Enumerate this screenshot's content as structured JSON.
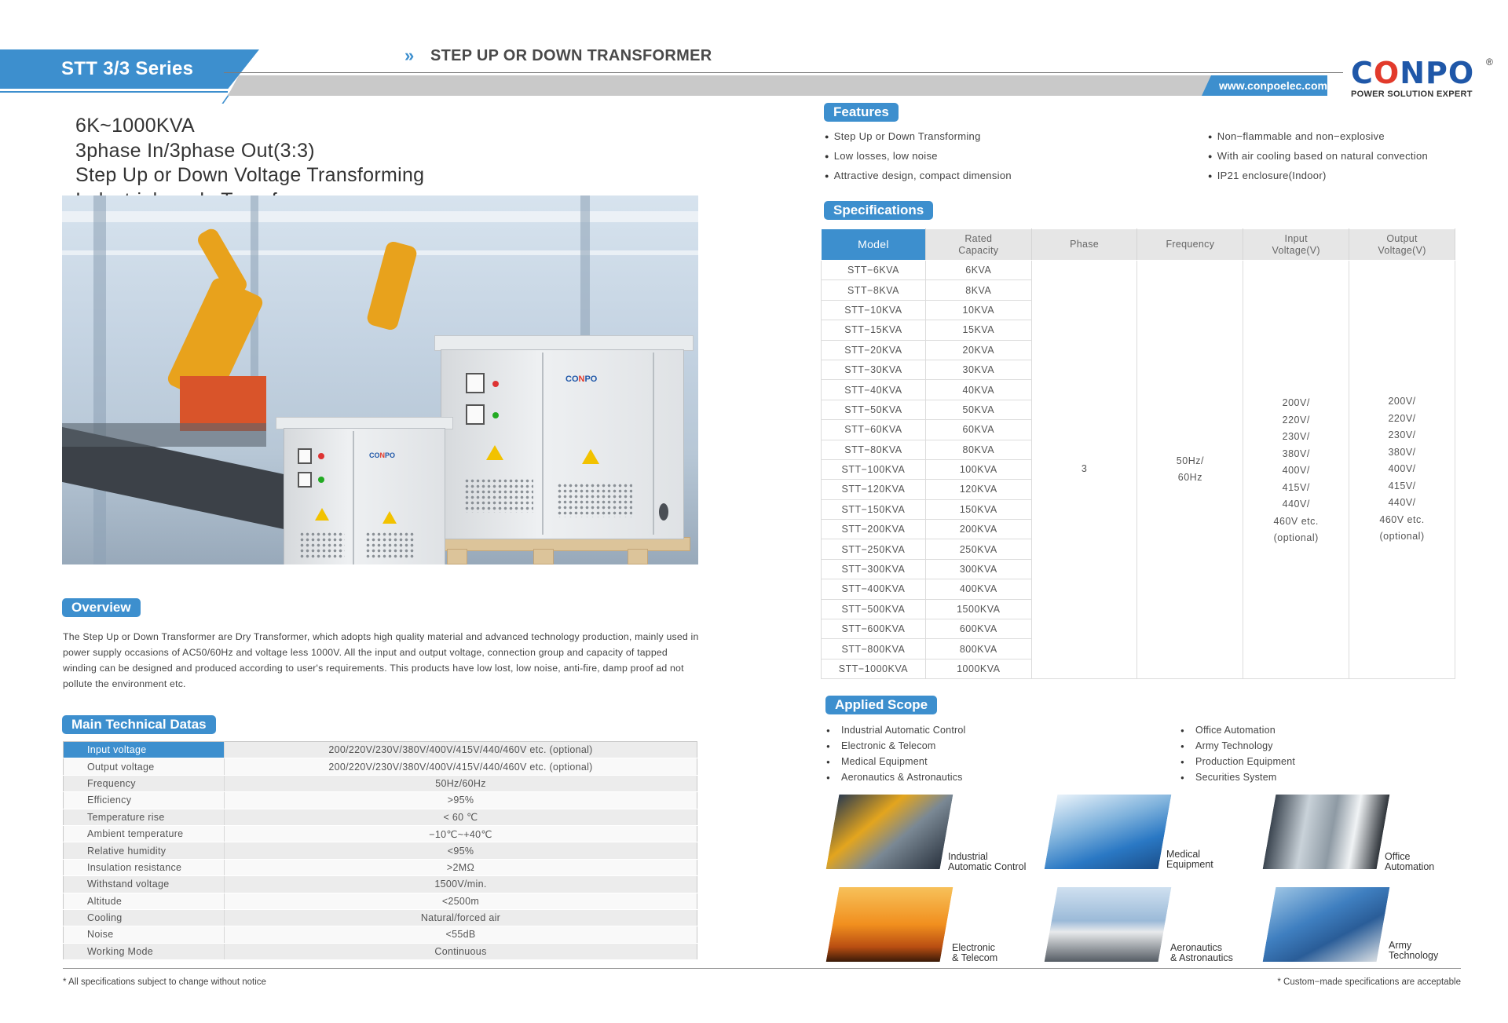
{
  "header": {
    "series_label": "STT 3/3 Series",
    "chevron": "»",
    "title": "STEP UP OR DOWN TRANSFORMER",
    "url": "www.conpoelec.com",
    "brand_word_start": "C",
    "brand_word_mid": "O",
    "brand_word_end": "NPO",
    "brand_registered": "®",
    "brand_tagline": "POWER SOLUTION EXPERT"
  },
  "headline": {
    "line1": "6K~1000KVA",
    "line2": "3phase In/3phase Out(3:3)",
    "line3": "Step Up or Down Voltage Transforming",
    "line4": "Industrial-grade Transformer"
  },
  "product_labels": {
    "cabinet_logo_start": "CO",
    "cabinet_logo_mid": "N",
    "cabinet_logo_end": "PO",
    "warning": "⚠"
  },
  "overview": {
    "heading": "Overview",
    "text": "The Step Up or Down Transformer are Dry Transformer, which adopts high quality material and advanced technology production, mainly used in power supply occasions of AC50/60Hz and voltage less 1000V.  All the input and output voltage, connection group and capacity of tapped winding can be designed and produced according to user's requirements. This products have low lost, low noise, anti-fire, damp proof ad not pollute the environment etc."
  },
  "tech": {
    "heading": "Main Technical Datas",
    "rows": [
      {
        "k": "Input voltage",
        "v": "200/220V/230V/380V/400V/415V/440/460V etc. (optional)"
      },
      {
        "k": "Output voltage",
        "v": "200/220V/230V/380V/400V/415V/440/460V etc. (optional)"
      },
      {
        "k": "Frequency",
        "v": "50Hz/60Hz"
      },
      {
        "k": "Efficiency",
        "v": ">95%"
      },
      {
        "k": "Temperature rise",
        "v": "< 60 ℃"
      },
      {
        "k": "Ambient temperature",
        "v": "−10℃~+40℃"
      },
      {
        "k": "Relative humidity",
        "v": "<95%"
      },
      {
        "k": "Insulation resistance",
        "v": ">2MΩ"
      },
      {
        "k": "Withstand voltage",
        "v": "1500V/min."
      },
      {
        "k": "Altitude",
        "v": "<2500m"
      },
      {
        "k": "Cooling",
        "v": "Natural/forced air"
      },
      {
        "k": "Noise",
        "v": "<55dB"
      },
      {
        "k": "Working Mode",
        "v": "Continuous"
      }
    ]
  },
  "features": {
    "heading": "Features",
    "left": [
      "Step Up or Down Transforming",
      "Low losses, low noise",
      "Attractive design, compact dimension"
    ],
    "right": [
      "Non−flammable and non−explosive",
      "With air cooling based on natural convection",
      "IP21 enclosure(Indoor)"
    ]
  },
  "specs": {
    "heading": "Specifications",
    "headers": {
      "model": "Model",
      "capacity_1": "Rated",
      "capacity_2": "Capacity",
      "phase": "Phase",
      "frequency": "Frequency",
      "input_1": "Input",
      "input_2": "Voltage(V)",
      "output_1": "Output",
      "output_2": "Voltage(V)"
    },
    "rows": [
      {
        "model": "STT−6KVA",
        "cap": "6KVA"
      },
      {
        "model": "STT−8KVA",
        "cap": "8KVA"
      },
      {
        "model": "STT−10KVA",
        "cap": "10KVA"
      },
      {
        "model": "STT−15KVA",
        "cap": "15KVA"
      },
      {
        "model": "STT−20KVA",
        "cap": "20KVA"
      },
      {
        "model": "STT−30KVA",
        "cap": "30KVA"
      },
      {
        "model": "STT−40KVA",
        "cap": "40KVA"
      },
      {
        "model": "STT−50KVA",
        "cap": "50KVA"
      },
      {
        "model": "STT−60KVA",
        "cap": "60KVA"
      },
      {
        "model": "STT−80KVA",
        "cap": "80KVA"
      },
      {
        "model": "STT−100KVA",
        "cap": "100KVA"
      },
      {
        "model": "STT−120KVA",
        "cap": "120KVA"
      },
      {
        "model": "STT−150KVA",
        "cap": "150KVA"
      },
      {
        "model": "STT−200KVA",
        "cap": "200KVA"
      },
      {
        "model": "STT−250KVA",
        "cap": "250KVA"
      },
      {
        "model": "STT−300KVA",
        "cap": "300KVA"
      },
      {
        "model": "STT−400KVA",
        "cap": "400KVA"
      },
      {
        "model": "STT−500KVA",
        "cap": "1500KVA"
      },
      {
        "model": "STT−600KVA",
        "cap": "600KVA"
      },
      {
        "model": "STT−800KVA",
        "cap": "800KVA"
      },
      {
        "model": "STT−1000KVA",
        "cap": "1000KVA"
      }
    ],
    "phase": "3",
    "frequency_1": "50Hz/",
    "frequency_2": "60Hz",
    "voltage_lines": [
      "200V/",
      "220V/",
      "230V/",
      "380V/",
      "400V/",
      "415V/",
      "440V/",
      "460V etc.",
      "(optional)"
    ]
  },
  "scope": {
    "heading": "Applied Scope",
    "left": [
      "Industrial Automatic Control",
      "Electronic & Telecom",
      "Medical Equipment",
      "Aeronautics & Astronautics"
    ],
    "right": [
      "Office Automation",
      "Army Technology",
      "Production Equipment",
      "Securities System"
    ],
    "thumbs": [
      {
        "l1": "Industrial",
        "l2": "Automatic Control"
      },
      {
        "l1": "Medical",
        "l2": "Equipment"
      },
      {
        "l1": "Office",
        "l2": "Automation"
      },
      {
        "l1": "Electronic",
        "l2": "& Telecom"
      },
      {
        "l1": "Aeronautics",
        "l2": "& Astronautics"
      },
      {
        "l1": "Army",
        "l2": "Technology"
      }
    ]
  },
  "footer": {
    "left": "* All specifications subject to change without notice",
    "right": "* Custom−made specifications are acceptable"
  }
}
